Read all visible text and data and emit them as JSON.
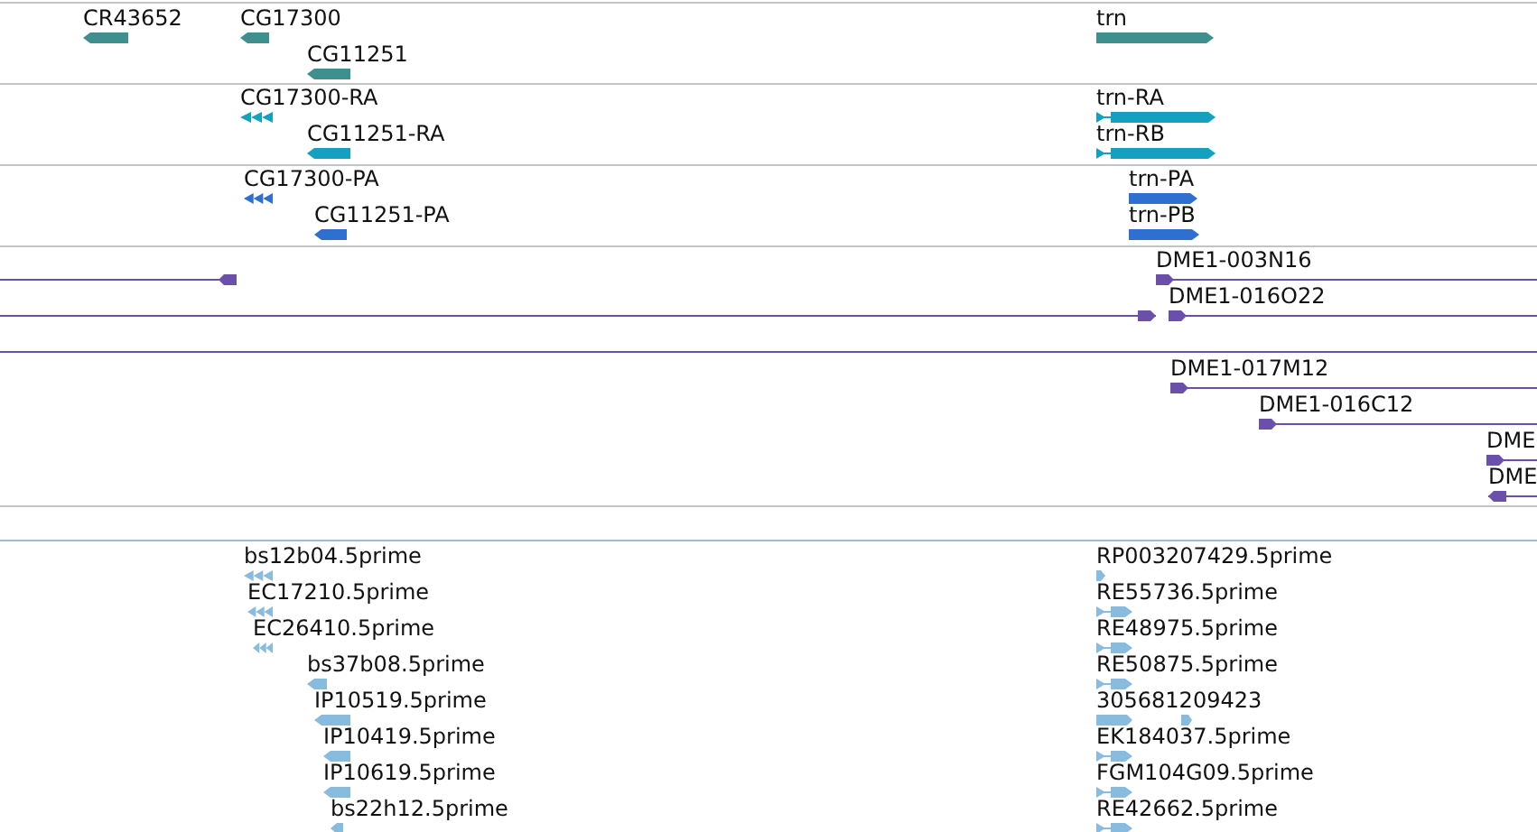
{
  "tracks": [
    {
      "kind": "gene",
      "features": [
        {
          "label": "CR43652",
          "kind": "block",
          "reverse": true
        },
        {
          "label": "CG17300",
          "kind": "block",
          "reverse": true
        },
        {
          "label": "CG11251",
          "kind": "block",
          "reverse": true
        },
        {
          "label": "trn",
          "kind": "block",
          "reverse": false
        }
      ]
    },
    {
      "kind": "transcript",
      "features": [
        {
          "label": "CG17300-RA",
          "kind": "chevrons",
          "reverse": true
        },
        {
          "label": "CG11251-RA",
          "kind": "block",
          "reverse": true
        },
        {
          "label": "trn-RA",
          "kind": "split",
          "reverse": false
        },
        {
          "label": "trn-RB",
          "kind": "split",
          "reverse": false
        }
      ]
    },
    {
      "kind": "protein",
      "features": [
        {
          "label": "CG17300-PA",
          "kind": "chevrons",
          "reverse": true
        },
        {
          "label": "CG11251-PA",
          "kind": "block",
          "reverse": true
        },
        {
          "label": "trn-PA",
          "kind": "block",
          "reverse": false
        },
        {
          "label": "trn-PB",
          "kind": "block",
          "reverse": false
        }
      ]
    },
    {
      "kind": "clone",
      "features": [
        {
          "kind": "line",
          "reverse": true
        },
        {
          "label": "DME1-003N16",
          "kind": "line",
          "reverse": false
        },
        {
          "kind": "line",
          "reverse": false
        },
        {
          "label": "DME1-016O22",
          "kind": "line",
          "reverse": false
        },
        {
          "kind": "line"
        },
        {
          "label": "DME1-017M12",
          "kind": "line",
          "reverse": false
        },
        {
          "label": "DME1-016C12",
          "kind": "line",
          "reverse": false
        },
        {
          "label": "DME",
          "kind": "line",
          "reverse": false
        },
        {
          "label": "DME",
          "kind": "line",
          "reverse": true
        }
      ]
    },
    {
      "kind": "spacer"
    },
    {
      "kind": "est",
      "features": [
        {
          "label": "bs12b04.5prime",
          "kind": "chevrons",
          "reverse": true
        },
        {
          "label": "RP003207429.5prime",
          "kind": "block",
          "reverse": false
        },
        {
          "label": "EC17210.5prime",
          "kind": "chevrons",
          "reverse": true
        },
        {
          "label": "RE55736.5prime",
          "kind": "split",
          "reverse": false
        },
        {
          "label": "EC26410.5prime",
          "kind": "chevrons",
          "reverse": true
        },
        {
          "label": "RE48975.5prime",
          "kind": "split",
          "reverse": false
        },
        {
          "label": "bs37b08.5prime",
          "kind": "block",
          "reverse": true
        },
        {
          "label": "RE50875.5prime",
          "kind": "split",
          "reverse": false
        },
        {
          "label": "IP10519.5prime",
          "kind": "block",
          "reverse": true
        },
        {
          "label": "305681209423",
          "kind": "gapped",
          "reverse": false
        },
        {
          "label": "IP10419.5prime",
          "kind": "block",
          "reverse": true
        },
        {
          "label": "EK184037.5prime",
          "kind": "split",
          "reverse": false
        },
        {
          "label": "IP10619.5prime",
          "kind": "block",
          "reverse": true
        },
        {
          "label": "FGM104G09.5prime",
          "kind": "split",
          "reverse": false
        },
        {
          "label": "bs22h12.5prime",
          "kind": "block",
          "reverse": true
        },
        {
          "label": "RE42662.5prime",
          "kind": "split",
          "reverse": false
        }
      ]
    }
  ]
}
